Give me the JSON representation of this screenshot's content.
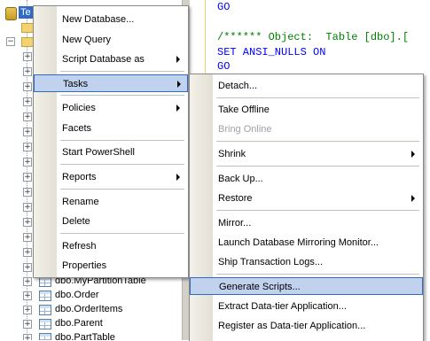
{
  "tree": {
    "root_label": "Te",
    "tables": [
      {
        "name": "dbo.MyPartitionTable"
      },
      {
        "name": "dbo.Order"
      },
      {
        "name": "dbo.OrderItems"
      },
      {
        "name": "dbo.Parent"
      },
      {
        "name": "dbo.PartTable"
      }
    ]
  },
  "editor": {
    "line1": "GO",
    "line2": "/****** Object:  Table [dbo].[",
    "line3": "SET ANSI_NULLS ON",
    "line4": "GO"
  },
  "context_menu": {
    "items": [
      {
        "label": "New Database..."
      },
      {
        "label": "New Query"
      },
      {
        "label": "Script Database as"
      },
      {
        "label": "Tasks"
      },
      {
        "label": "Policies"
      },
      {
        "label": "Facets"
      },
      {
        "label": "Start PowerShell"
      },
      {
        "label": "Reports"
      },
      {
        "label": "Rename"
      },
      {
        "label": "Delete"
      },
      {
        "label": "Refresh"
      },
      {
        "label": "Properties"
      }
    ]
  },
  "tasks_menu": {
    "items": [
      {
        "label": "Detach..."
      },
      {
        "label": "Take Offline"
      },
      {
        "label": "Bring Online"
      },
      {
        "label": "Shrink"
      },
      {
        "label": "Back Up..."
      },
      {
        "label": "Restore"
      },
      {
        "label": "Mirror..."
      },
      {
        "label": "Launch Database Mirroring Monitor..."
      },
      {
        "label": "Ship Transaction Logs..."
      },
      {
        "label": "Generate Scripts..."
      },
      {
        "label": "Extract Data-tier Application..."
      },
      {
        "label": "Register as Data-tier Application..."
      }
    ]
  },
  "colors": {
    "selection_fill": "#c1d2ee",
    "selection_border": "#316ac5",
    "code_keyword": "#0000ff",
    "code_comment": "#008000"
  }
}
